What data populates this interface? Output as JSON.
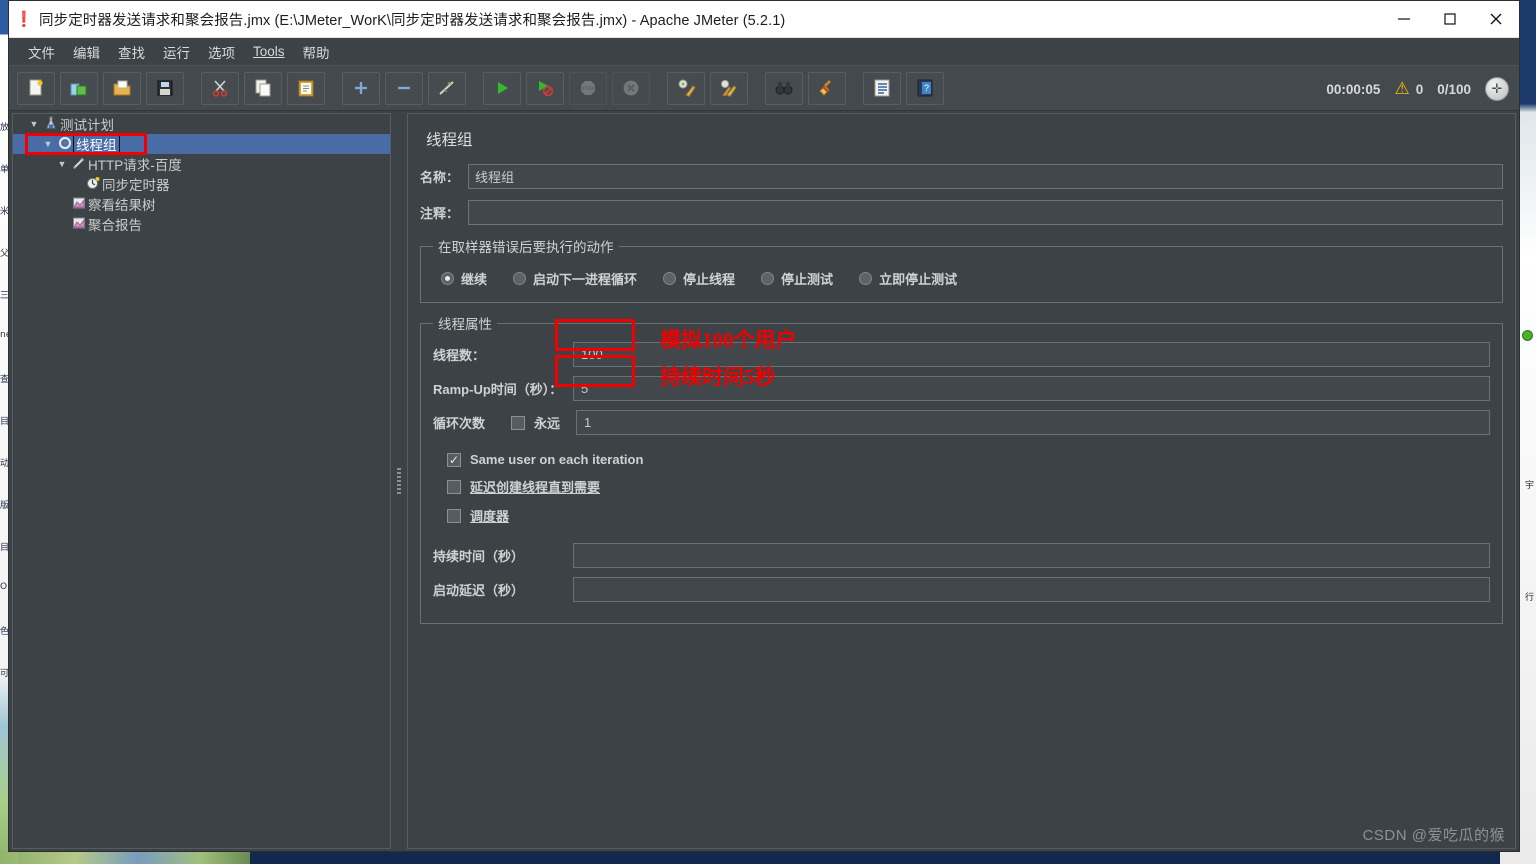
{
  "window": {
    "title": "同步定时器发送请求和聚会报告.jmx (E:\\JMeter_WorK\\同步定时器发送请求和聚会报告.jmx) - Apache JMeter (5.2.1)",
    "app_icon": "jmeter-feather-icon",
    "minimize_label": "—",
    "maximize_label": "□",
    "close_label": "✕"
  },
  "menubar": {
    "items": [
      {
        "label": "文件",
        "name": "menu-file"
      },
      {
        "label": "编辑",
        "name": "menu-edit"
      },
      {
        "label": "查找",
        "name": "menu-search"
      },
      {
        "label": "运行",
        "name": "menu-run"
      },
      {
        "label": "选项",
        "name": "menu-options"
      },
      {
        "label": "Tools",
        "name": "menu-tools"
      },
      {
        "label": "帮助",
        "name": "menu-help"
      }
    ]
  },
  "toolbar": {
    "buttons": [
      {
        "icon": "new-document-icon",
        "glyph": "📄",
        "name": "new-button"
      },
      {
        "icon": "templates-icon",
        "glyph": "📚",
        "name": "templates-button"
      },
      {
        "icon": "open-folder-icon",
        "glyph": "📂",
        "name": "open-button"
      },
      {
        "icon": "save-floppy-icon",
        "glyph": "💾",
        "name": "save-button"
      },
      {
        "icon": "scissors-cut-icon",
        "glyph": "✂",
        "name": "cut-button"
      },
      {
        "icon": "copy-pages-icon",
        "glyph": "❐",
        "name": "copy-button"
      },
      {
        "icon": "clipboard-paste-icon",
        "glyph": "📋",
        "name": "paste-button"
      },
      {
        "icon": "plus-expand-icon",
        "glyph": "＋",
        "name": "expand-all-button"
      },
      {
        "icon": "minus-collapse-icon",
        "glyph": "－",
        "name": "collapse-all-button"
      },
      {
        "icon": "toggle-pencil-icon",
        "glyph": "✎",
        "name": "toggle-button"
      },
      {
        "icon": "start-play-icon",
        "glyph": "▶",
        "name": "start-button"
      },
      {
        "icon": "start-no-pauses-icon",
        "glyph": "▶",
        "name": "start-no-timers-button"
      },
      {
        "icon": "stop-sign-icon",
        "glyph": "⬣",
        "name": "stop-button"
      },
      {
        "icon": "shutdown-circle-icon",
        "glyph": "✖",
        "name": "shutdown-button"
      },
      {
        "icon": "clear-broom-gear-icon",
        "glyph": "🧹",
        "name": "clear-button"
      },
      {
        "icon": "clear-all-broom-icon",
        "glyph": "🧹",
        "name": "clear-all-button"
      },
      {
        "icon": "binoculars-search-icon",
        "glyph": "🔍",
        "name": "search-button"
      },
      {
        "icon": "reset-broom-icon",
        "glyph": "🖌",
        "name": "reset-search-button"
      },
      {
        "icon": "function-helper-icon",
        "glyph": "▤",
        "name": "function-helper-button"
      },
      {
        "icon": "help-book-icon",
        "glyph": "?",
        "name": "help-button"
      }
    ],
    "status": {
      "elapsed_time": "00:00:05",
      "warning_icon": "warning-triangle-icon",
      "warning_count": "0",
      "threads_running": "0/100",
      "threads_icon": "thread-indicator-icon"
    }
  },
  "tree": {
    "items": [
      {
        "label": "测试计划",
        "icon": "test-plan-icon",
        "glyph": "⚗",
        "indent": 0,
        "twisty": "▼",
        "selected": false
      },
      {
        "label": "线程组",
        "icon": "thread-group-gear-icon",
        "glyph": "⚙",
        "indent": 1,
        "twisty": "▼",
        "selected": true
      },
      {
        "label": "HTTP请求-百度",
        "icon": "http-sampler-pencil-icon",
        "glyph": "✎",
        "indent": 2,
        "twisty": "▼",
        "selected": false
      },
      {
        "label": "同步定时器",
        "icon": "timer-clock-icon",
        "glyph": "⏱",
        "indent": 3,
        "twisty": "",
        "selected": false
      },
      {
        "label": "察看结果树",
        "icon": "view-results-tree-icon",
        "glyph": "📈",
        "indent": 2,
        "twisty": "",
        "selected": false
      },
      {
        "label": "聚合报告",
        "icon": "aggregate-report-icon",
        "glyph": "📈",
        "indent": 2,
        "twisty": "",
        "selected": false
      }
    ]
  },
  "main": {
    "panel_title": "线程组",
    "name_label": "名称：",
    "name_value": "线程组",
    "comment_label": "注释：",
    "comment_value": "",
    "error_action": {
      "legend": "在取样器错误后要执行的动作",
      "options": [
        {
          "label": "继续",
          "selected": true
        },
        {
          "label": "启动下一进程循环",
          "selected": false
        },
        {
          "label": "停止线程",
          "selected": false
        },
        {
          "label": "停止测试",
          "selected": false
        },
        {
          "label": "立即停止测试",
          "selected": false
        }
      ]
    },
    "thread_properties": {
      "legend": "线程属性",
      "threads_label": "线程数：",
      "threads_value": "100",
      "rampup_label": "Ramp-Up时间（秒）：",
      "rampup_value": "5",
      "loops_label": "循环次数",
      "forever_label": "永远",
      "forever_checked": false,
      "loops_value": "1",
      "same_user_label": "Same user on each iteration",
      "same_user_checked": true,
      "delay_create_label": "延迟创建线程直到需要",
      "delay_create_checked": false,
      "scheduler_label": "调度器",
      "scheduler_checked": false,
      "duration_label": "持续时间（秒）",
      "duration_value": "",
      "startup_delay_label": "启动延迟（秒）",
      "startup_delay_value": ""
    }
  },
  "annotations": {
    "color": "#f20000",
    "notes": [
      {
        "text": "模拟100个用户",
        "name": "annotation-simulate-100-users"
      },
      {
        "text": "持续时间5秒",
        "name": "annotation-duration-5-seconds"
      }
    ]
  },
  "watermark": "CSDN @爱吃瓜的猴",
  "background": {
    "left_strip_lines": [
      "放",
      "单",
      "米",
      "父",
      "三",
      "ne",
      "查",
      "目",
      "动",
      "版",
      "目",
      "OI",
      "色",
      "可"
    ],
    "right_lines": [
      "宇",
      "行"
    ]
  }
}
